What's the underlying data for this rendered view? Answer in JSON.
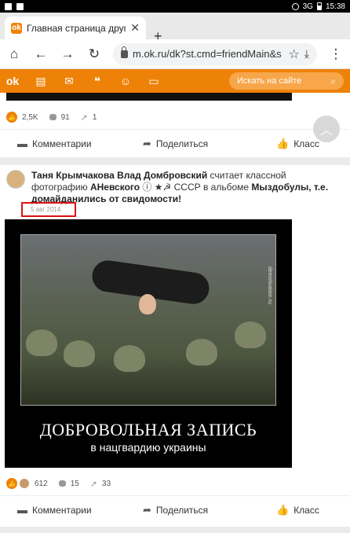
{
  "status_bar": {
    "time": "15:38",
    "network": "3G"
  },
  "tab": {
    "title": "Главная страница друга",
    "close": "✕",
    "new_tab": "+"
  },
  "address": {
    "url": "m.ok.ru/dk?st.cmd=friendMain&s"
  },
  "ok_nav": {
    "search_placeholder": "Искать на сайте"
  },
  "posts": [
    {
      "stats": {
        "likes": "2,5K",
        "comments": "91",
        "shares": "1"
      },
      "actions": {
        "comments": "Комментарии",
        "share": "Поделиться",
        "like": "Класс"
      }
    },
    {
      "author": "Таня Крымчакова Влад Домбровский",
      "verb": "считает классной фотографию",
      "owner": "АНевского",
      "owner_suffix": "ⓘ ★☭ СССР",
      "in_album": "в альбоме",
      "album": "Мыздобулы, т.е. домайданились от свидомости!",
      "date": "5 авг 2014",
      "image": {
        "caption_main": "ДОБРОВОЛЬНАЯ ЗАПИСЬ",
        "caption_sub": "в нацгвардию украины",
        "watermark": "demotivation.ru"
      },
      "stats": {
        "likes": "612",
        "comments": "15",
        "shares": "33"
      },
      "actions": {
        "comments": "Комментарии",
        "share": "Поделиться",
        "like": "Класс"
      }
    }
  ],
  "colors": {
    "accent": "#ee8208",
    "highlight_box": "#dd1111"
  },
  "icons": [
    "home-icon",
    "back-icon",
    "forward-icon",
    "reload-icon",
    "lock-icon",
    "star-icon",
    "download-icon",
    "menu-icon",
    "ok-logo-icon",
    "feed-icon",
    "messages-icon",
    "discussions-icon",
    "friends-icon",
    "wallet-icon",
    "search-icon",
    "scroll-top-icon"
  ]
}
